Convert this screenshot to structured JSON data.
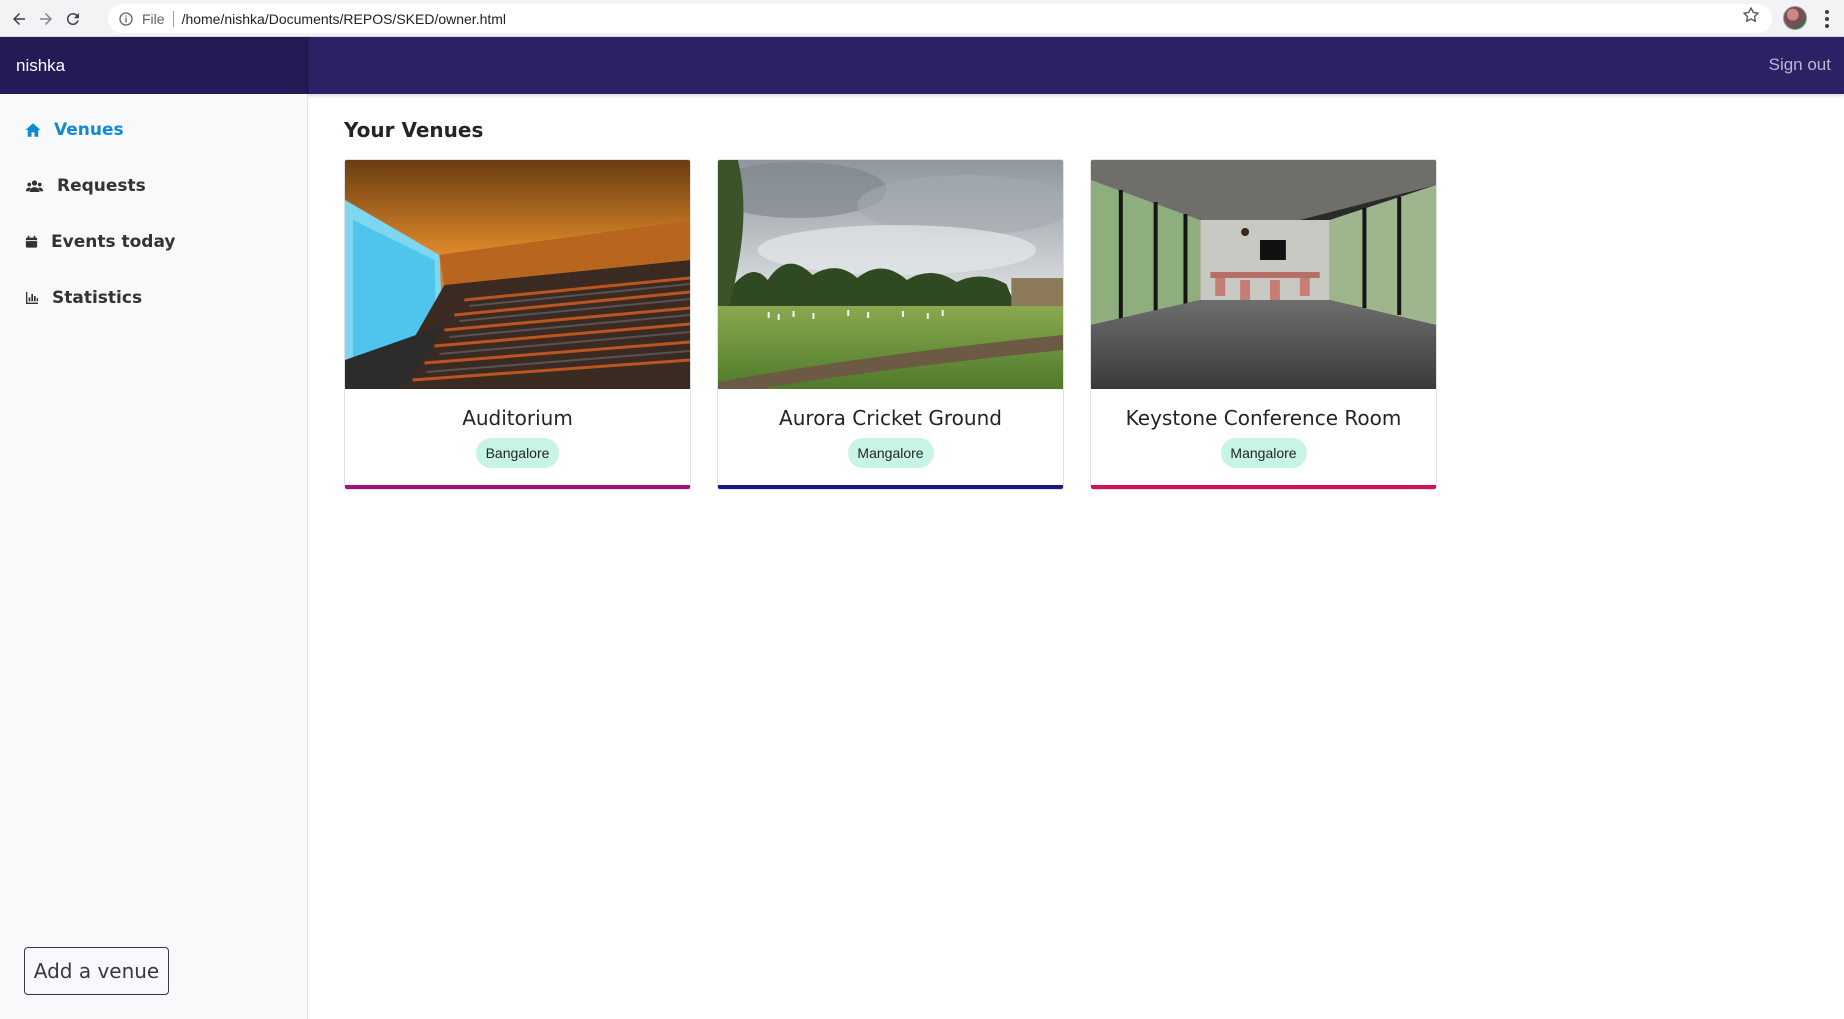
{
  "browser": {
    "file_label": "File",
    "url": "/home/nishka/Documents/REPOS/SKED/owner.html"
  },
  "navbar": {
    "brand": "nishka",
    "signout": "Sign out"
  },
  "sidebar": {
    "items": [
      {
        "label": "Venues",
        "icon": "home-icon",
        "active": true
      },
      {
        "label": "Requests",
        "icon": "users-icon",
        "active": false
      },
      {
        "label": "Events today",
        "icon": "calendar-icon",
        "active": false
      },
      {
        "label": "Statistics",
        "icon": "bar-chart-icon",
        "active": false
      }
    ],
    "add_button": "Add a venue"
  },
  "main": {
    "title": "Your Venues",
    "venues": [
      {
        "name": "Auditorium",
        "city": "Bangalore",
        "accent": "#a0117d",
        "image": "auditorium-photo"
      },
      {
        "name": "Aurora Cricket Ground",
        "city": "Mangalore",
        "accent": "#1e1680",
        "image": "cricket-ground-photo"
      },
      {
        "name": "Keystone Conference Room",
        "city": "Mangalore",
        "accent": "#d01257",
        "image": "conference-room-photo"
      }
    ]
  },
  "colors": {
    "navbar": "#2b2266",
    "brand_bg": "#221b55",
    "active_link": "#0d8ad6",
    "badge_bg": "#c8f4e6"
  }
}
